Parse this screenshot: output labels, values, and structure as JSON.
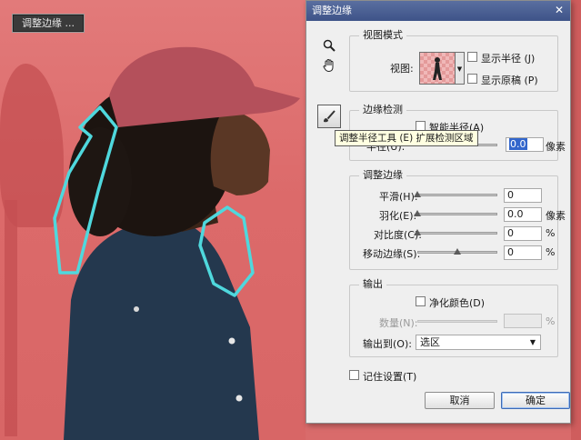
{
  "canvas": {
    "refine_button_label": "调整边缘 ..."
  },
  "dialog": {
    "title": "调整边缘",
    "close_glyph": "✕",
    "view_mode": {
      "title": "视图模式",
      "view_label": "视图:",
      "show_radius_label": "显示半径 (J)",
      "show_original_label": "显示原稿 (P)"
    },
    "edge_detection": {
      "title": "边缘检测",
      "smart_radius_label": "智能半径(A)",
      "radius_label": "半径(U):",
      "radius_value": "0.0",
      "radius_unit": "像素"
    },
    "tooltip": "调整半径工具 (E) 扩展检测区域",
    "adjust_edge": {
      "title": "调整边缘",
      "rows": [
        {
          "label": "平滑(H):",
          "value": "0",
          "unit": ""
        },
        {
          "label": "羽化(E):",
          "value": "0.0",
          "unit": "像素"
        },
        {
          "label": "对比度(C):",
          "value": "0",
          "unit": "%"
        },
        {
          "label": "移动边缘(S):",
          "value": "0",
          "unit": "%"
        }
      ]
    },
    "output": {
      "title": "输出",
      "decontaminate_label": "净化颜色(D)",
      "amount_label": "数量(N):",
      "amount_value": "",
      "amount_unit": "%",
      "output_to_label": "输出到(O):",
      "output_to_value": "选区"
    },
    "remember_label": "记住设置(T)",
    "cancel_label": "取消",
    "ok_label": "确定"
  }
}
